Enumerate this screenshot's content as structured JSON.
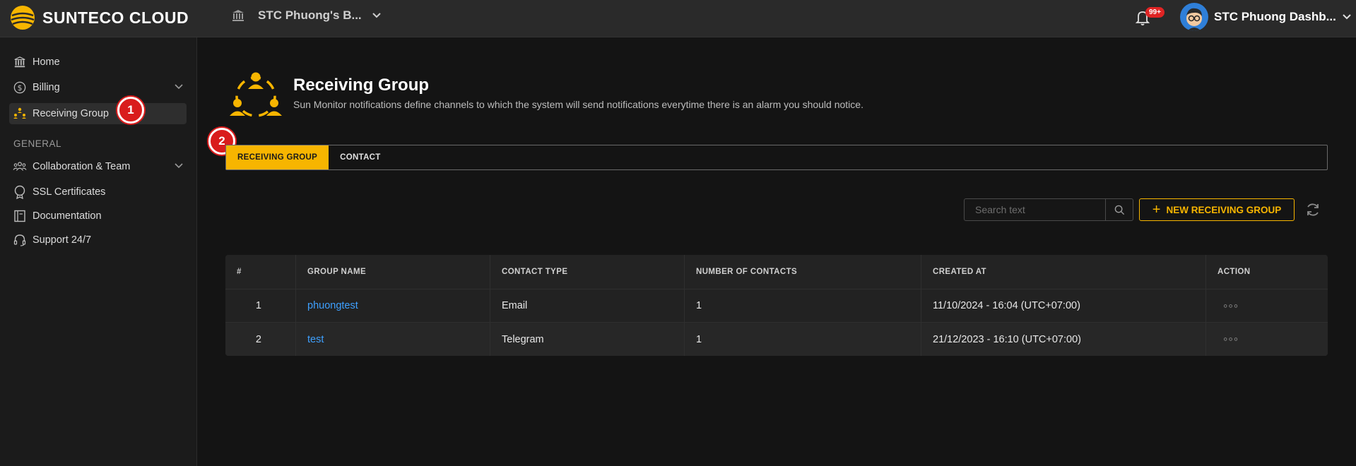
{
  "brand": {
    "name": "SUNTECO CLOUD"
  },
  "workspace": {
    "label": "STC Phuong's B..."
  },
  "notifications": {
    "badge": "99+"
  },
  "user": {
    "name": "STC Phuong Dashb..."
  },
  "sidebar": {
    "items": [
      {
        "label": "Home",
        "icon": "bank-icon"
      },
      {
        "label": "Billing",
        "icon": "dollar-icon"
      },
      {
        "label": "Receiving Group",
        "icon": "group-icon"
      }
    ],
    "section_general": "GENERAL",
    "general_items": [
      {
        "label": "Collaboration & Team",
        "icon": "team-icon"
      },
      {
        "label": "SSL Certificates",
        "icon": "certificate-icon"
      },
      {
        "label": "Documentation",
        "icon": "book-icon"
      },
      {
        "label": "Support 24/7",
        "icon": "headset-icon"
      }
    ]
  },
  "markers": {
    "m1": "1",
    "m2": "2"
  },
  "page": {
    "title": "Receiving Group",
    "subtitle": "Sun Monitor notifications define channels to which the system will send notifications everytime there is an alarm you should notice."
  },
  "tabs": [
    {
      "label": "RECEIVING GROUP",
      "active": true
    },
    {
      "label": "CONTACT",
      "active": false
    }
  ],
  "toolbar": {
    "search_placeholder": "Search text",
    "new_button": "NEW RECEIVING GROUP"
  },
  "table": {
    "headers": [
      "#",
      "GROUP NAME",
      "CONTACT TYPE",
      "NUMBER OF CONTACTS",
      "CREATED AT",
      "ACTION"
    ],
    "rows": [
      {
        "index": "1",
        "group_name": "phuongtest",
        "contact_type": "Email",
        "contacts": "1",
        "created_at": "11/10/2024 - 16:04 (UTC+07:00)",
        "action": "◦◦◦"
      },
      {
        "index": "2",
        "group_name": "test",
        "contact_type": "Telegram",
        "contacts": "1",
        "created_at": "21/12/2023 - 16:10 (UTC+07:00)",
        "action": "◦◦◦"
      }
    ]
  },
  "colors": {
    "accent": "#f7b500",
    "link": "#3ea0ff",
    "marker": "#d91c1c"
  }
}
